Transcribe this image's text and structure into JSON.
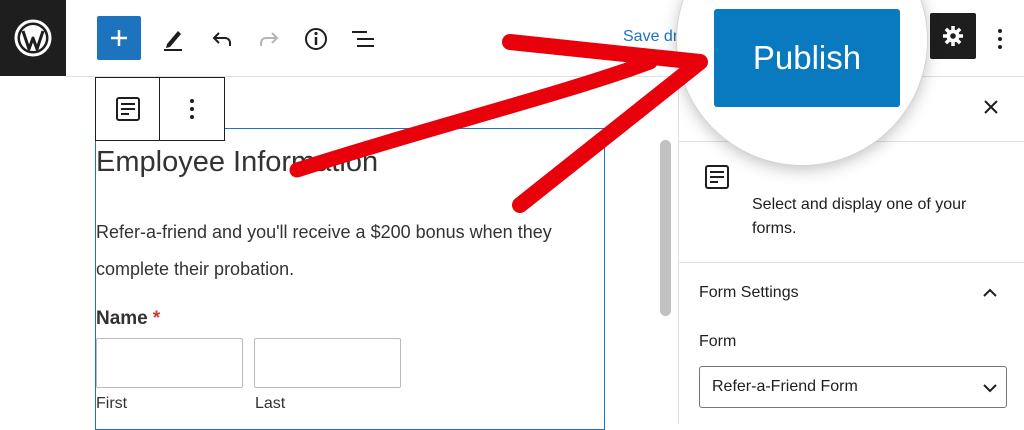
{
  "toolbar": {
    "save_draft_label": "Save draft",
    "icons": [
      "wordpress-icon",
      "plus-icon",
      "pencil-icon",
      "undo-icon",
      "redo-icon",
      "info-icon",
      "list-view-icon",
      "gear-icon",
      "more-vertical-icon"
    ]
  },
  "block_toolbar": {
    "icons": [
      "form-block-icon",
      "more-vertical-icon"
    ]
  },
  "form": {
    "title": "Employee Information",
    "description": "Refer-a-friend and you'll receive a $200 bonus when they complete their probation.",
    "name_label": "Name",
    "required_mark": "*",
    "first_label": "First",
    "last_label": "Last"
  },
  "sidebar": {
    "block_description": "Select and display one of your forms.",
    "panel_title": "Form Settings",
    "form_label": "Form",
    "form_selected": "Refer-a-Friend Form"
  },
  "publish": {
    "label": "Publish"
  },
  "colors": {
    "accent": "#1e73be",
    "publish": "#0a7ac0",
    "dark": "#1e1e1e",
    "annotation_arrow": "#e8000b",
    "required": "#d63638"
  }
}
